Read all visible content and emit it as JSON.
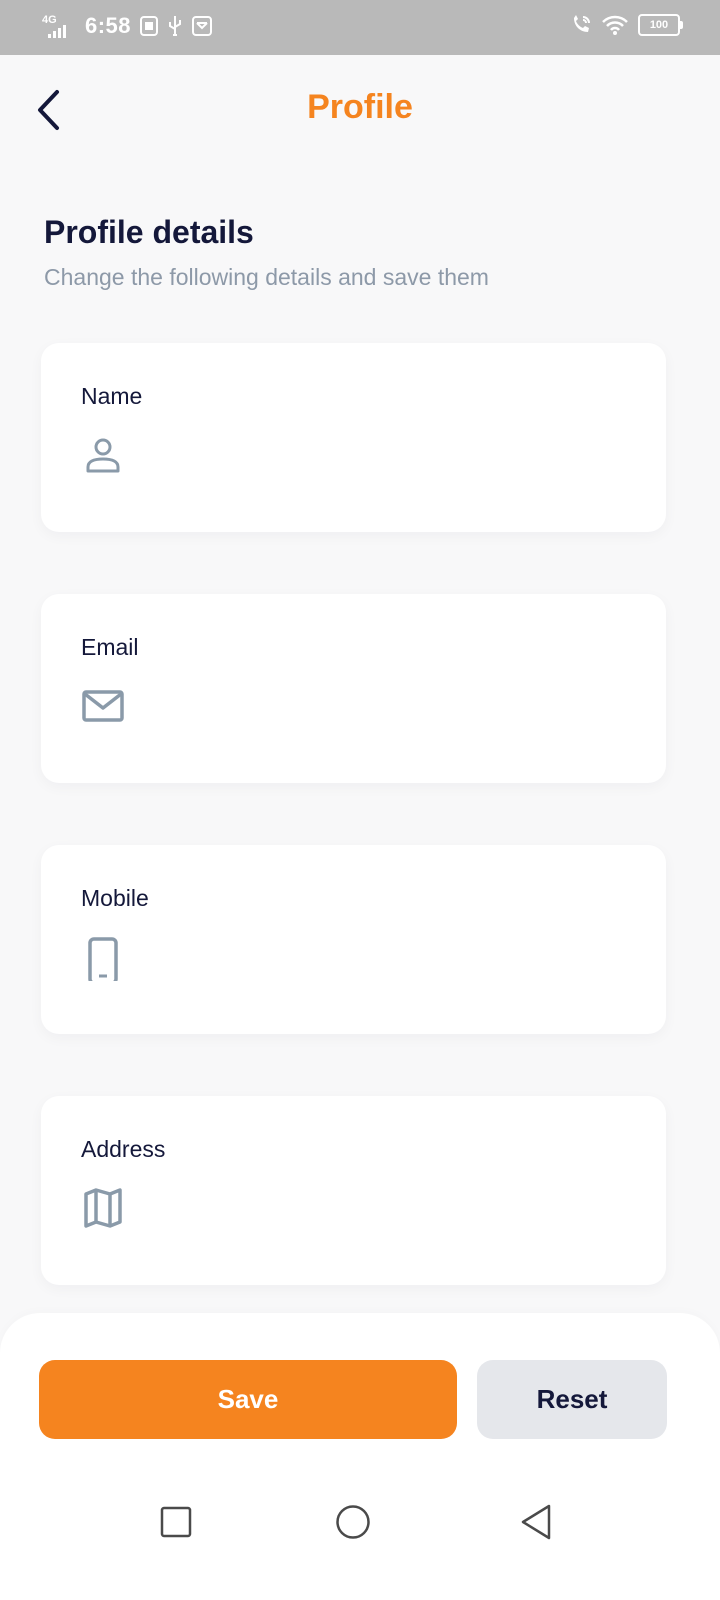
{
  "status_bar": {
    "network": "4G",
    "time": "6:58",
    "battery": "100"
  },
  "header": {
    "title": "Profile"
  },
  "section": {
    "title": "Profile details",
    "subtitle": "Change the following details and save them"
  },
  "fields": [
    {
      "label": "Name",
      "icon": "person-icon",
      "value": ""
    },
    {
      "label": "Email",
      "icon": "mail-icon",
      "value": ""
    },
    {
      "label": "Mobile",
      "icon": "phone-icon",
      "value": ""
    },
    {
      "label": "Address",
      "icon": "map-icon",
      "value": ""
    }
  ],
  "actions": {
    "save_label": "Save",
    "reset_label": "Reset"
  },
  "colors": {
    "accent": "#f5841f",
    "text": "#14183a",
    "muted": "#8d99a8",
    "icon": "#8a9aa9",
    "reset_bg": "#e5e7eb"
  }
}
